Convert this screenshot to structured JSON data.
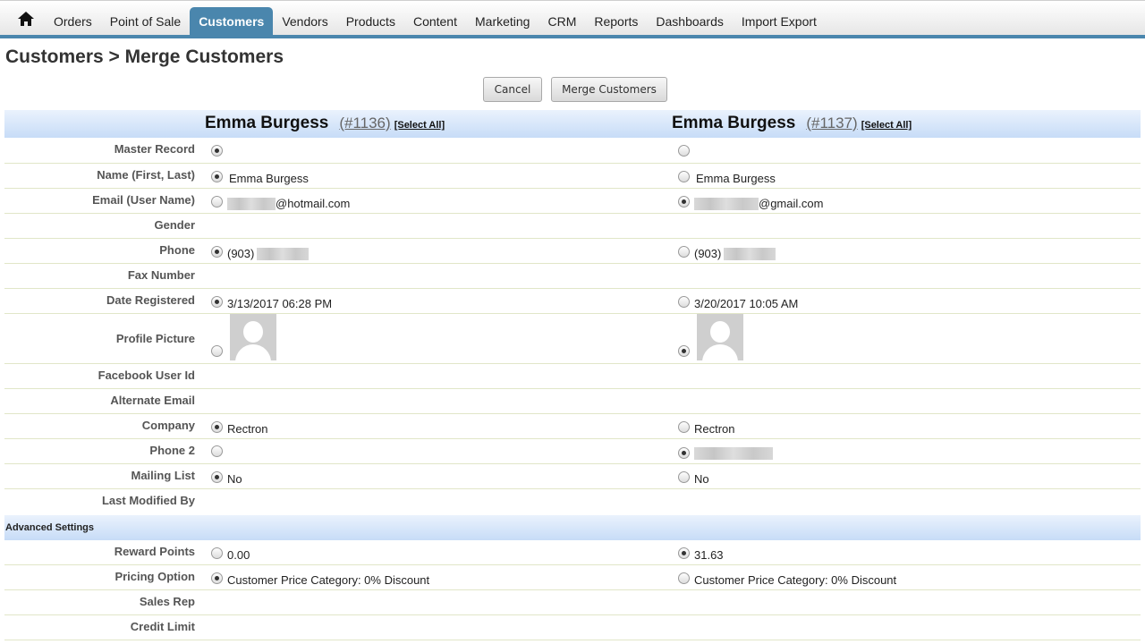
{
  "nav": {
    "home_icon": "home-icon",
    "tabs": [
      "Orders",
      "Point of Sale",
      "Customers",
      "Vendors",
      "Products",
      "Content",
      "Marketing",
      "CRM",
      "Reports",
      "Dashboards",
      "Import Export"
    ],
    "active_tab": "Customers",
    "accent_color": "#4a86ad"
  },
  "page": {
    "title": "Customers > Merge Customers"
  },
  "actions": {
    "cancel_label": "Cancel",
    "merge_label": "Merge Customers"
  },
  "customers": [
    {
      "name": "Emma Burgess",
      "id": "(#1136)",
      "select_all": "[Select All]"
    },
    {
      "name": "Emma Burgess",
      "id": "(#1137)",
      "select_all": "[Select All]"
    }
  ],
  "fields": {
    "master_record": {
      "label": "Master Record",
      "left": "",
      "right": "",
      "selected": "left"
    },
    "name": {
      "label": "Name (First, Last)",
      "left": "Emma Burgess",
      "right": "Emma Burgess",
      "selected": "left"
    },
    "email": {
      "label": "Email (User Name)",
      "left": "@hotmail.com",
      "right": "@gmail.com",
      "selected": "right"
    },
    "gender": {
      "label": "Gender"
    },
    "phone": {
      "label": "Phone",
      "left": "(903)",
      "right": "(903)",
      "selected": "left"
    },
    "fax": {
      "label": "Fax Number"
    },
    "date_registered": {
      "label": "Date Registered",
      "left": "3/13/2017 06:28 PM",
      "right": "3/20/2017 10:05 AM",
      "selected": "left"
    },
    "profile_picture": {
      "label": "Profile Picture",
      "selected": "right"
    },
    "facebook": {
      "label": "Facebook User Id"
    },
    "alt_email": {
      "label": "Alternate Email"
    },
    "company": {
      "label": "Company",
      "left": "Rectron",
      "right": "Rectron",
      "selected": "left"
    },
    "phone2": {
      "label": "Phone 2",
      "left": "",
      "right": "",
      "selected": "right"
    },
    "mailing_list": {
      "label": "Mailing List",
      "left": "No",
      "right": "No",
      "selected": "left"
    },
    "last_modified": {
      "label": "Last Modified By"
    }
  },
  "advanced": {
    "title": "Advanced Settings",
    "reward_points": {
      "label": "Reward Points",
      "left": "0.00",
      "right": "31.63",
      "selected": "right"
    },
    "pricing_option": {
      "label": "Pricing Option",
      "left": "Customer Price Category: 0% Discount",
      "right": "Customer Price Category: 0% Discount",
      "selected": "left"
    },
    "sales_rep": {
      "label": "Sales Rep"
    },
    "credit_limit": {
      "label": "Credit Limit"
    }
  }
}
